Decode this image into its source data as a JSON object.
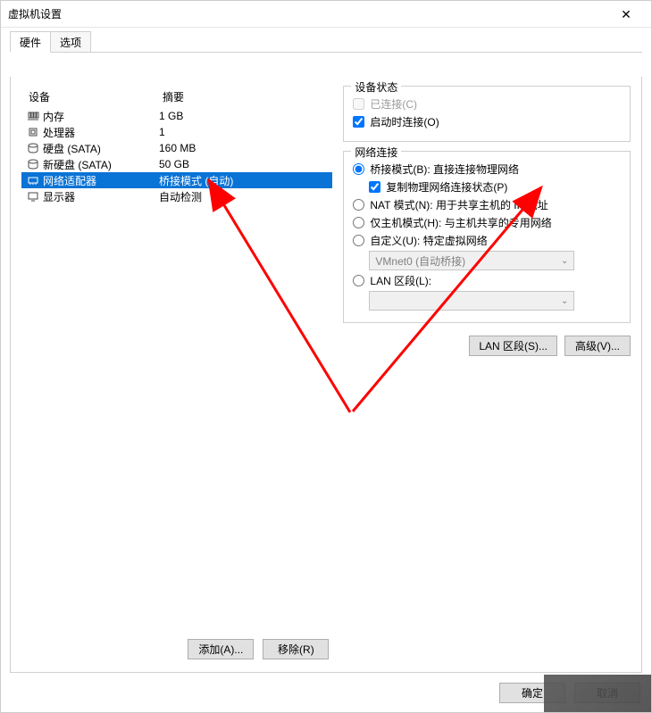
{
  "title": "虚拟机设置",
  "tabs": {
    "hardware": "硬件",
    "options": "选项"
  },
  "headers": {
    "device": "设备",
    "summary": "摘要"
  },
  "devices": [
    {
      "icon": "ram",
      "name": "内存",
      "summary": "1 GB",
      "selected": false
    },
    {
      "icon": "cpu",
      "name": "处理器",
      "summary": "1",
      "selected": false
    },
    {
      "icon": "disk",
      "name": "硬盘 (SATA)",
      "summary": "160 MB",
      "selected": false
    },
    {
      "icon": "disk",
      "name": "新硬盘 (SATA)",
      "summary": "50 GB",
      "selected": false
    },
    {
      "icon": "net",
      "name": "网络适配器",
      "summary": "桥接模式 (自动)",
      "selected": true
    },
    {
      "icon": "display",
      "name": "显示器",
      "summary": "自动检测",
      "selected": false
    }
  ],
  "left_buttons": {
    "add": "添加(A)...",
    "remove": "移除(R)"
  },
  "status": {
    "legend": "设备状态",
    "connected": "已连接(C)",
    "connect_on_start": "启动时连接(O)"
  },
  "net": {
    "legend": "网络连接",
    "bridged": "桥接模式(B): 直接连接物理网络",
    "replicate": "复制物理网络连接状态(P)",
    "nat": "NAT 模式(N): 用于共享主机的 IP 地址",
    "hostonly": "仅主机模式(H): 与主机共享的专用网络",
    "custom": "自定义(U): 特定虚拟网络",
    "custom_value": "VMnet0 (自动桥接)",
    "lan": "LAN 区段(L):",
    "lan_value": "",
    "lan_segments_btn": "LAN 区段(S)...",
    "advanced_btn": "高级(V)..."
  },
  "dialog": {
    "ok": "确定",
    "cancel": "取消"
  },
  "annotation_color": "#ff0000"
}
